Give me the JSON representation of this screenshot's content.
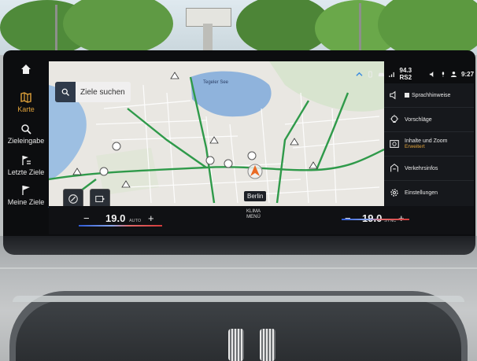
{
  "sidebar": {
    "items": [
      {
        "label": "Karte",
        "icon": "map-icon",
        "active": true
      },
      {
        "label": "Zieleingabe",
        "icon": "search-icon",
        "active": false
      },
      {
        "label": "Letzte Ziele",
        "icon": "recent-destinations-icon",
        "active": false
      },
      {
        "label": "Meine Ziele",
        "icon": "flag-icon",
        "active": false
      }
    ]
  },
  "map": {
    "search_label": "Ziele suchen",
    "current_city": "Berlin",
    "lake_label": "Tegeler See"
  },
  "status": {
    "radio": "94.3 RS2",
    "time": "9:27"
  },
  "menu": {
    "items": [
      {
        "label": "Sprachhinweise",
        "icon": "speaker-icon",
        "checked": true
      },
      {
        "label": "Vorschläge",
        "icon": "bulb-icon"
      },
      {
        "label": "Inhalte und Zoom",
        "sub": "Erweitert",
        "icon": "zoom-content-icon"
      },
      {
        "label": "Verkehrsinfos",
        "icon": "traffic-icon"
      },
      {
        "label": "Einstellungen",
        "icon": "gear-icon"
      }
    ]
  },
  "climate": {
    "left": {
      "minus": "−",
      "temp": "19.0",
      "mode": "AUTO",
      "plus": "+"
    },
    "center": {
      "line1": "KLIMA",
      "line2": "MENÜ"
    },
    "right": {
      "minus": "−",
      "temp": "19.0",
      "mode": "SYNC",
      "plus": "+"
    }
  },
  "colors": {
    "accent": "#e0a23a",
    "map_bg": "#e9e7e2",
    "traffic_green": "#2f9a4a",
    "water": "#8fb3dc",
    "display_bg": "#0c0d0f"
  }
}
